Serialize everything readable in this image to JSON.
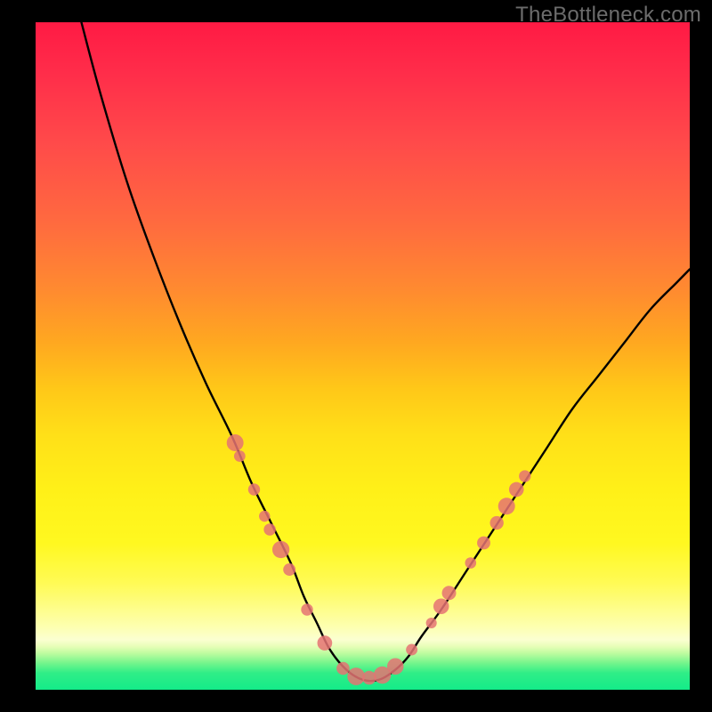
{
  "watermark": "TheBottleneck.com",
  "chart_data": {
    "type": "line",
    "title": "",
    "xlabel": "",
    "ylabel": "",
    "xlim": [
      0,
      100
    ],
    "ylim": [
      0,
      100
    ],
    "grid": false,
    "legend": false,
    "background_gradient": {
      "direction": "vertical",
      "stops": [
        {
          "pct": 0,
          "color": "#ff1a44"
        },
        {
          "pct": 50,
          "color": "#ffb018"
        },
        {
          "pct": 85,
          "color": "#fcff70"
        },
        {
          "pct": 100,
          "color": "#14eb89"
        }
      ]
    },
    "series": [
      {
        "name": "bottleneck-curve",
        "color": "#000000",
        "x": [
          7,
          10,
          14,
          18,
          22,
          26,
          30,
          33,
          36,
          39,
          41,
          43,
          45,
          47.5,
          50,
          52.5,
          55,
          57,
          59,
          62,
          66,
          70,
          74,
          78,
          82,
          86,
          90,
          94,
          98,
          100
        ],
        "values": [
          100,
          89,
          76,
          65,
          55,
          46,
          38,
          31,
          25,
          19,
          14,
          10,
          6,
          3,
          1.5,
          1.5,
          3,
          5,
          8,
          12,
          18,
          24,
          30,
          36,
          42,
          47,
          52,
          57,
          61,
          63
        ]
      }
    ],
    "markers": {
      "name": "data-points",
      "color": "#e57373",
      "radius_px_range": [
        6,
        10
      ],
      "points": [
        {
          "x": 30.5,
          "y": 37
        },
        {
          "x": 31.2,
          "y": 35
        },
        {
          "x": 33.4,
          "y": 30
        },
        {
          "x": 35.0,
          "y": 26
        },
        {
          "x": 35.8,
          "y": 24
        },
        {
          "x": 37.5,
          "y": 21
        },
        {
          "x": 38.8,
          "y": 18
        },
        {
          "x": 41.5,
          "y": 12
        },
        {
          "x": 44.2,
          "y": 7
        },
        {
          "x": 47.0,
          "y": 3.2
        },
        {
          "x": 49.0,
          "y": 2.0
        },
        {
          "x": 51.0,
          "y": 1.8
        },
        {
          "x": 53.0,
          "y": 2.2
        },
        {
          "x": 55.0,
          "y": 3.5
        },
        {
          "x": 57.5,
          "y": 6
        },
        {
          "x": 60.5,
          "y": 10
        },
        {
          "x": 62.0,
          "y": 12.5
        },
        {
          "x": 63.2,
          "y": 14.5
        },
        {
          "x": 66.5,
          "y": 19
        },
        {
          "x": 68.5,
          "y": 22
        },
        {
          "x": 70.5,
          "y": 25
        },
        {
          "x": 72.0,
          "y": 27.5
        },
        {
          "x": 73.5,
          "y": 30
        },
        {
          "x": 74.8,
          "y": 32
        }
      ]
    }
  }
}
